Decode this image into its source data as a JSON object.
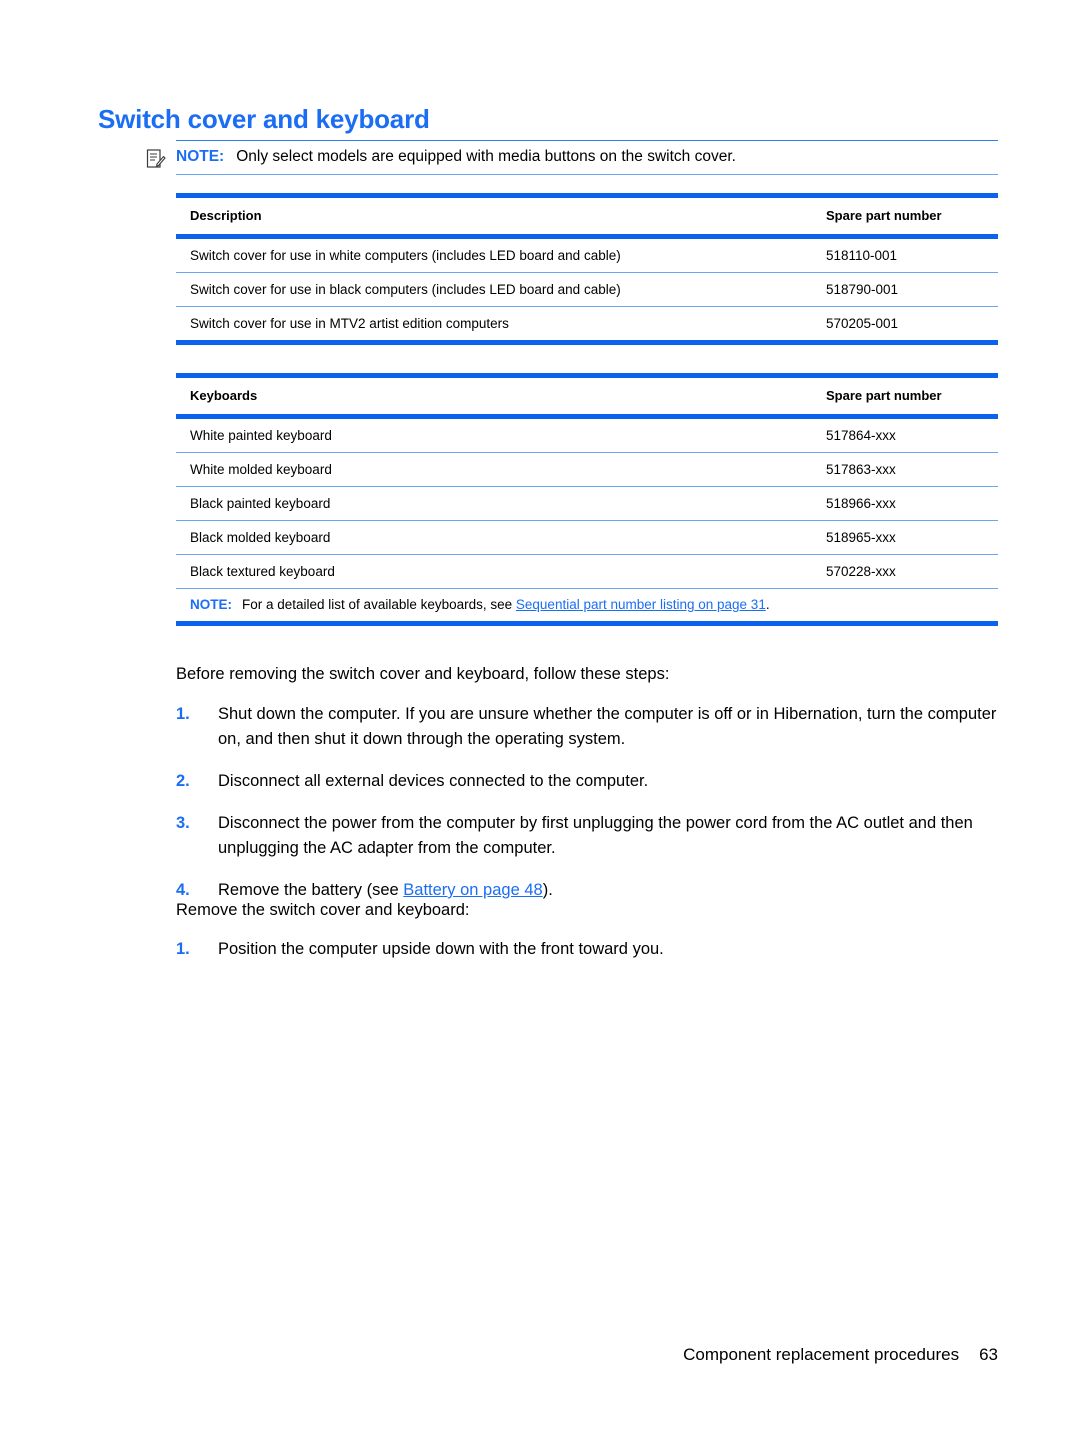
{
  "document": {
    "heading": "Switch cover and keyboard",
    "top_note": {
      "icon": "note-pad-pencil-icon",
      "label": "NOTE:",
      "text": "Only select models are equipped with media buttons on the switch cover."
    },
    "switch_cover_table": {
      "headers": [
        "Description",
        "Spare part number"
      ],
      "rows": [
        [
          "Switch cover for use in white computers (includes LED board and cable)",
          "518110-001"
        ],
        [
          "Switch cover for use in black computers (includes LED board and cable)",
          "518790-001"
        ],
        [
          "Switch cover for use in MTV2 artist edition computers",
          "570205-001"
        ]
      ]
    },
    "keyboards_table": {
      "headers": [
        "Keyboards",
        "Spare part number"
      ],
      "rows": [
        [
          "White painted keyboard",
          "517864-xxx"
        ],
        [
          "White molded keyboard",
          "517863-xxx"
        ],
        [
          "Black painted keyboard",
          "518966-xxx"
        ],
        [
          "Black molded keyboard",
          "518965-xxx"
        ],
        [
          "Black textured keyboard",
          "570228-xxx"
        ]
      ],
      "footer_note": {
        "label": "NOTE:",
        "text_before_link": "For a detailed list of available keyboards, see ",
        "link_text": "Sequential part number listing on page 31",
        "text_after_link": "."
      }
    },
    "intro_paragraph": "Before removing the switch cover and keyboard, follow these steps:",
    "before_steps": [
      {
        "num": "1.",
        "text": "Shut down the computer. If you are unsure whether the computer is off or in Hibernation, turn the computer on, and then shut it down through the operating system."
      },
      {
        "num": "2.",
        "text": "Disconnect all external devices connected to the computer."
      },
      {
        "num": "3.",
        "text": "Disconnect the power from the computer by first unplugging the power cord from the AC outlet and then unplugging the AC adapter from the computer."
      }
    ],
    "battery_step": {
      "num": "4.",
      "text_before_link": "Remove the battery (see ",
      "link_text": "Battery on page 48",
      "text_after_link": ")."
    },
    "remove_paragraph": "Remove the switch cover and keyboard:",
    "remove_steps": [
      {
        "num": "1.",
        "text": "Position the computer upside down with the front toward you."
      }
    ],
    "footer": {
      "title": "Component replacement procedures",
      "page_number": "63"
    }
  },
  "colors": {
    "heading_blue": "#1b6ef3",
    "rule_blue": "#0b62ef",
    "rule_light_blue": "#69a6f2",
    "link_blue": "#1b6ef3"
  }
}
